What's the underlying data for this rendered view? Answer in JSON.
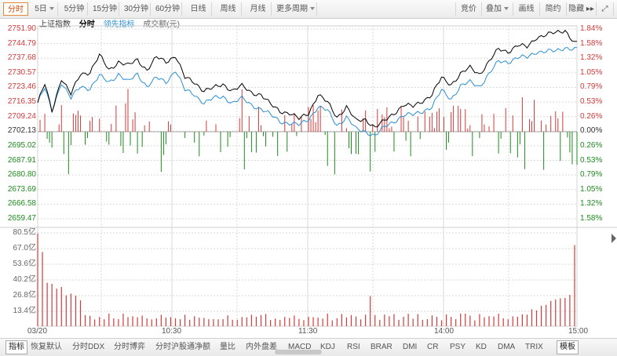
{
  "toolbar": {
    "left": [
      {
        "label": "分时",
        "active": true,
        "dropdown": false
      },
      {
        "label": "5日",
        "active": false,
        "dropdown": true
      },
      {
        "label": "5分钟",
        "active": false,
        "dropdown": false
      },
      {
        "label": "15分钟",
        "active": false,
        "dropdown": false
      },
      {
        "label": "30分钟",
        "active": false,
        "dropdown": false
      },
      {
        "label": "60分钟",
        "active": false,
        "dropdown": false
      },
      {
        "label": "日线",
        "active": false,
        "dropdown": false
      },
      {
        "label": "周线",
        "active": false,
        "dropdown": false
      },
      {
        "label": "月线",
        "active": false,
        "dropdown": false
      },
      {
        "label": "更多周期",
        "active": false,
        "dropdown": true
      }
    ],
    "right": [
      {
        "label": "竞价",
        "dropdown": false
      },
      {
        "label": "叠加",
        "dropdown": true
      },
      {
        "label": "画线",
        "dropdown": false
      },
      {
        "label": "简约",
        "dropdown": false
      },
      {
        "label": "隐藏 ▸▸",
        "dropdown": false
      },
      {
        "label": "⤢",
        "dropdown": false
      }
    ]
  },
  "legend": {
    "index_name": "上证指数",
    "mode": "分时",
    "lead_indicator": "领先指标",
    "volume_label": "成交额(元)"
  },
  "colors": {
    "up": "#d43a3a",
    "down": "#1f8a1f",
    "price_line": "#000000",
    "lead_line": "#2a8fd0",
    "grid": "#d9d9d9",
    "volume": "#d43a3a"
  },
  "chart_data": {
    "type": "line",
    "prev_close": 2702.13,
    "price_ylim": [
      2659.47,
      2751.9
    ],
    "price_ticks": [
      "2751.90",
      "2744.79",
      "2737.68",
      "2730.57",
      "2723.46",
      "2716.35",
      "2709.24",
      "2702.13",
      "2695.02",
      "2687.91",
      "2680.80",
      "2673.69",
      "2666.58",
      "2659.47"
    ],
    "pct_ticks": [
      "1.84%",
      "1.58%",
      "1.32%",
      "1.05%",
      "0.79%",
      "0.53%",
      "0.26%",
      "0.00%",
      "0.26%",
      "0.53%",
      "0.79%",
      "1.05%",
      "1.32%",
      "1.58%"
    ],
    "volume_ticks": [
      "80.5亿",
      "67.0亿",
      "53.6亿",
      "40.2亿",
      "26.8亿",
      "13.4亿"
    ],
    "x_labels": [
      "03/20",
      "10:30",
      "11:30",
      "14:00",
      "15:00"
    ],
    "price_keypoints": [
      [
        0,
        2716
      ],
      [
        3,
        2725
      ],
      [
        6,
        2712
      ],
      [
        10,
        2728
      ],
      [
        14,
        2720
      ],
      [
        18,
        2730
      ],
      [
        22,
        2731
      ],
      [
        26,
        2739
      ],
      [
        30,
        2732
      ],
      [
        34,
        2736
      ],
      [
        38,
        2734
      ],
      [
        42,
        2737
      ],
      [
        46,
        2732
      ],
      [
        50,
        2738
      ],
      [
        54,
        2736
      ],
      [
        58,
        2739
      ],
      [
        62,
        2728
      ],
      [
        66,
        2726
      ],
      [
        70,
        2722
      ],
      [
        74,
        2723
      ],
      [
        78,
        2725
      ],
      [
        82,
        2722
      ],
      [
        86,
        2724
      ],
      [
        90,
        2721
      ],
      [
        94,
        2720
      ],
      [
        98,
        2715
      ],
      [
        102,
        2712
      ],
      [
        106,
        2711
      ],
      [
        110,
        2708
      ],
      [
        114,
        2711
      ],
      [
        118,
        2720
      ],
      [
        122,
        2716
      ],
      [
        126,
        2709
      ],
      [
        130,
        2714
      ],
      [
        134,
        2707
      ],
      [
        138,
        2708
      ],
      [
        142,
        2704
      ],
      [
        146,
        2707
      ],
      [
        150,
        2711
      ],
      [
        154,
        2715
      ],
      [
        158,
        2714
      ],
      [
        162,
        2717
      ],
      [
        166,
        2720
      ],
      [
        170,
        2728
      ],
      [
        174,
        2725
      ],
      [
        178,
        2730
      ],
      [
        182,
        2733
      ],
      [
        186,
        2730
      ],
      [
        190,
        2736
      ],
      [
        194,
        2742
      ],
      [
        198,
        2741
      ],
      [
        202,
        2744
      ],
      [
        206,
        2743
      ],
      [
        210,
        2748
      ],
      [
        214,
        2749
      ],
      [
        218,
        2750
      ],
      [
        222,
        2751.5
      ],
      [
        226,
        2745
      ]
    ],
    "lead_keypoints": [
      [
        0,
        2716
      ],
      [
        3,
        2723
      ],
      [
        6,
        2712
      ],
      [
        10,
        2726
      ],
      [
        14,
        2718
      ],
      [
        18,
        2724
      ],
      [
        22,
        2723
      ],
      [
        26,
        2729
      ],
      [
        30,
        2726
      ],
      [
        34,
        2730
      ],
      [
        38,
        2726
      ],
      [
        42,
        2730
      ],
      [
        46,
        2724
      ],
      [
        50,
        2728
      ],
      [
        54,
        2726
      ],
      [
        58,
        2732
      ],
      [
        62,
        2722
      ],
      [
        66,
        2720
      ],
      [
        70,
        2716
      ],
      [
        74,
        2718
      ],
      [
        78,
        2719
      ],
      [
        82,
        2716
      ],
      [
        86,
        2718
      ],
      [
        90,
        2715
      ],
      [
        94,
        2713
      ],
      [
        98,
        2710
      ],
      [
        102,
        2707
      ],
      [
        106,
        2706
      ],
      [
        110,
        2705
      ],
      [
        114,
        2708
      ],
      [
        118,
        2714
      ],
      [
        122,
        2712
      ],
      [
        126,
        2705
      ],
      [
        130,
        2709
      ],
      [
        134,
        2703
      ],
      [
        138,
        2702
      ],
      [
        142,
        2700
      ],
      [
        146,
        2704
      ],
      [
        150,
        2707
      ],
      [
        154,
        2710
      ],
      [
        158,
        2710
      ],
      [
        162,
        2712
      ],
      [
        166,
        2714
      ],
      [
        170,
        2722
      ],
      [
        174,
        2718
      ],
      [
        178,
        2724
      ],
      [
        182,
        2726
      ],
      [
        186,
        2724
      ],
      [
        190,
        2730
      ],
      [
        194,
        2736
      ],
      [
        198,
        2736
      ],
      [
        202,
        2738
      ],
      [
        206,
        2738
      ],
      [
        210,
        2741
      ],
      [
        214,
        2741
      ],
      [
        218,
        2741
      ],
      [
        222,
        2743
      ],
      [
        226,
        2742
      ]
    ]
  },
  "bottombar": [
    {
      "label": "指标",
      "active": true
    },
    {
      "label": "恢复默认",
      "active": false
    },
    {
      "label": "分时DDX",
      "active": false
    },
    {
      "label": "分时博弈",
      "active": false
    },
    {
      "label": "分时沪股通净额",
      "active": false
    },
    {
      "label": "量比",
      "active": false
    },
    {
      "label": "内外盘差",
      "active": false
    },
    {
      "label": "MACD",
      "active": false
    },
    {
      "label": "KDJ",
      "active": false
    },
    {
      "label": "RSI",
      "active": false
    },
    {
      "label": "BRAR",
      "active": false
    },
    {
      "label": "DMI",
      "active": false
    },
    {
      "label": "CR",
      "active": false
    },
    {
      "label": "PSY",
      "active": false
    },
    {
      "label": "KD",
      "active": false
    },
    {
      "label": "DMA",
      "active": false
    },
    {
      "label": "TRIX",
      "active": false
    },
    {
      "label": "模板",
      "active": true
    }
  ]
}
